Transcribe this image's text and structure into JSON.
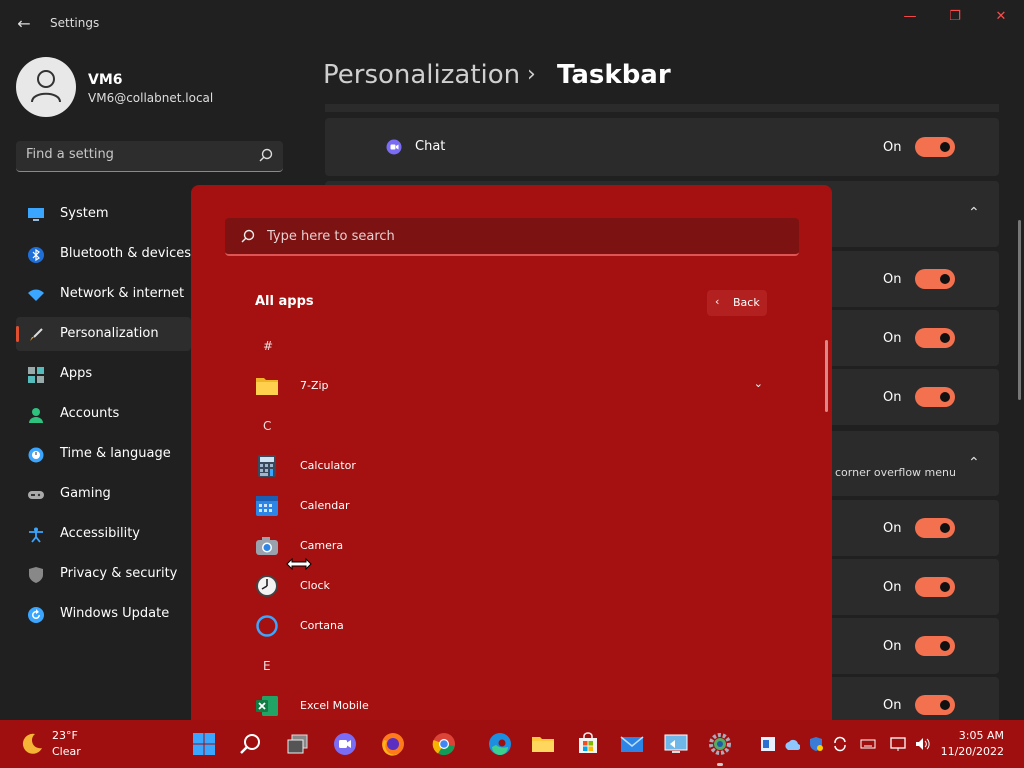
{
  "window": {
    "title": "Settings"
  },
  "profile": {
    "name": "VM6",
    "email": "VM6@collabnet.local"
  },
  "search": {
    "placeholder": "Find a setting"
  },
  "nav": [
    {
      "label": "System",
      "icon": "monitor-icon"
    },
    {
      "label": "Bluetooth & devices",
      "icon": "bluetooth-icon"
    },
    {
      "label": "Network & internet",
      "icon": "wifi-icon"
    },
    {
      "label": "Personalization",
      "icon": "brush-icon",
      "selected": true
    },
    {
      "label": "Apps",
      "icon": "apps-icon"
    },
    {
      "label": "Accounts",
      "icon": "person-icon"
    },
    {
      "label": "Time & language",
      "icon": "globe-clock-icon"
    },
    {
      "label": "Gaming",
      "icon": "gamepad-icon"
    },
    {
      "label": "Accessibility",
      "icon": "accessibility-icon"
    },
    {
      "label": "Privacy & security",
      "icon": "shield-icon"
    },
    {
      "label": "Windows Update",
      "icon": "update-icon"
    }
  ],
  "header": {
    "parent": "Personalization",
    "separator": "›",
    "current": "Taskbar"
  },
  "settings": {
    "chat": {
      "label": "Chat",
      "state": "On"
    },
    "rows_group1": [
      "On",
      "On",
      "On"
    ],
    "overflow": {
      "label": "corner overflow menu"
    },
    "rows_group2": [
      "On",
      "On",
      "On",
      "On"
    ]
  },
  "start_menu": {
    "search_placeholder": "Type here to search",
    "all_apps": "All apps",
    "back": "Back",
    "sections": [
      {
        "letter": "#",
        "apps": [
          {
            "name": "7-Zip",
            "icon": "folder-icon",
            "expandable": true
          }
        ]
      },
      {
        "letter": "C",
        "apps": [
          {
            "name": "Calculator",
            "icon": "calculator-icon"
          },
          {
            "name": "Calendar",
            "icon": "calendar-icon"
          },
          {
            "name": "Camera",
            "icon": "camera-icon"
          },
          {
            "name": "Clock",
            "icon": "clock-icon"
          },
          {
            "name": "Cortana",
            "icon": "cortana-icon"
          }
        ]
      },
      {
        "letter": "E",
        "apps": [
          {
            "name": "Excel Mobile",
            "icon": "excel-icon"
          }
        ]
      }
    ]
  },
  "taskbar": {
    "weather": {
      "temp": "23°F",
      "condition": "Clear"
    },
    "clock": {
      "time": "3:05 AM",
      "date": "11/20/2022"
    }
  },
  "colors": {
    "accent": "#f4714f",
    "start_bg": "#a51010",
    "taskbar_bg": "#a00f0f"
  }
}
